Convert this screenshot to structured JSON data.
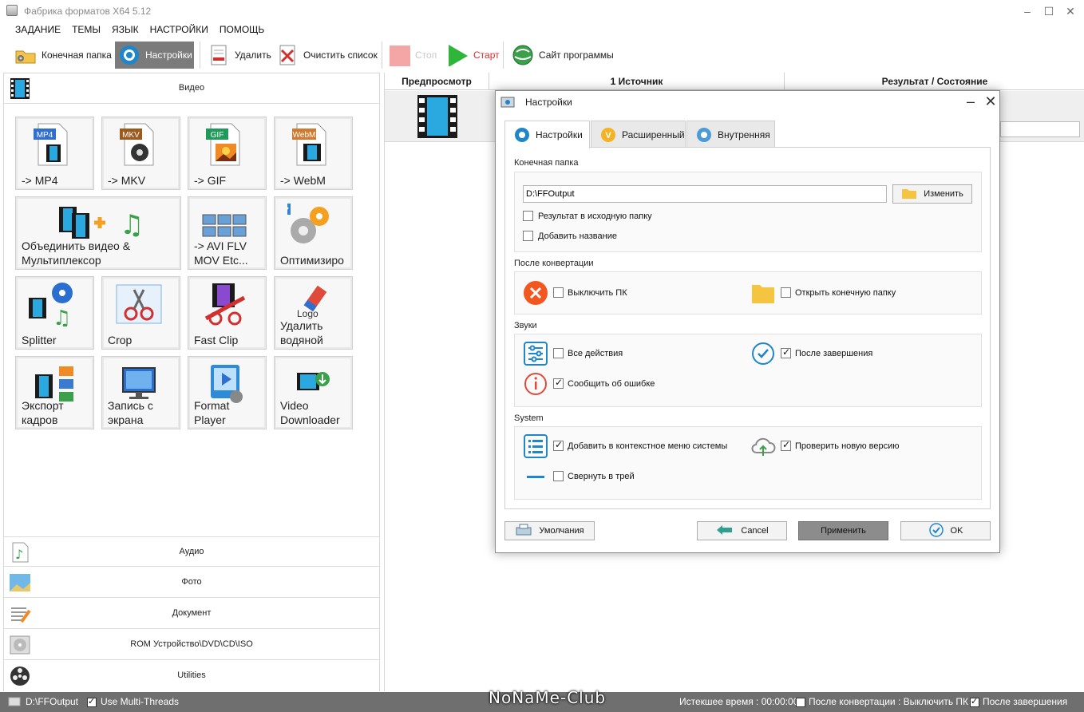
{
  "window": {
    "title": "Фабрика форматов X64 5.12",
    "minimize": "–",
    "maximize": "☐",
    "close": "✕"
  },
  "menu": [
    "ЗАДАНИЕ",
    "ТЕМЫ",
    "ЯЗЫК",
    "НАСТРОЙКИ",
    "ПОМОЩЬ"
  ],
  "toolbar": {
    "output_folder": "Конечная папка",
    "settings": "Настройки",
    "remove": "Удалить",
    "clear_list": "Очистить список",
    "stop": "Стоп",
    "start": "Старт",
    "website": "Сайт программы"
  },
  "left": {
    "video_header": "Видео",
    "tiles": [
      {
        "label": "-> MP4",
        "icon": "mp4-file-icon",
        "badge": "MP4",
        "badge_color": "#2f6fd0"
      },
      {
        "label": "-> MKV",
        "icon": "mkv-file-icon",
        "badge": "MKV",
        "badge_color": "#9c5a1c"
      },
      {
        "label": "-> GIF",
        "icon": "gif-file-icon",
        "badge": "GIF",
        "badge_color": "#1f9a5a"
      },
      {
        "label": "-> WebM",
        "icon": "webm-file-icon",
        "badge": "WebM",
        "badge_color": "#d07a2f"
      },
      {
        "label": "Объединить видео &\nМультиплексор",
        "icon": "join-video-icon"
      },
      {
        "label": "-> AVI FLV\nMOV Etc...",
        "icon": "multi-format-icon"
      },
      {
        "label": "Оптимизиро",
        "icon": "optimize-icon"
      },
      {
        "label": "Splitter",
        "icon": "splitter-icon"
      },
      {
        "label": "Crop",
        "icon": "crop-icon"
      },
      {
        "label": "Fast Clip",
        "icon": "fast-clip-icon"
      },
      {
        "label": "Удалить\nводяной",
        "icon": "remove-watermark-icon",
        "icon_text": "Logo"
      },
      {
        "label": "Экспорт\nкадров",
        "icon": "export-frames-icon"
      },
      {
        "label": "Запись с\nэкрана",
        "icon": "screen-record-icon"
      },
      {
        "label": "Format\nPlayer",
        "icon": "format-player-icon"
      },
      {
        "label": "Video\nDownloader",
        "icon": "video-downloader-icon"
      }
    ],
    "categories": [
      "Аудио",
      "Фото",
      "Документ",
      "ROM Устройство\\DVD\\CD\\ISO",
      "Utilities"
    ]
  },
  "file_list": {
    "columns": [
      "Предпросмотр",
      "1 Источник",
      "Результат / Состояние"
    ]
  },
  "status": {
    "folder": "D:\\FFOutput",
    "multithread": "Use Multi-Threads",
    "elapsed": "Истекшее время : 00:00:00",
    "after_convert": "После конвертации : Выключить ПК",
    "on_complete": "После завершения",
    "watermark": "NoNaMe-Club"
  },
  "dialog": {
    "title": "Настройки",
    "tabs": [
      "Настройки",
      "Расширенный",
      "Внутренняя"
    ],
    "output": {
      "title": "Конечная папка",
      "path": "D:\\FFOutput",
      "change": "Изменить",
      "to_source": "Результат в исходную папку",
      "to_source_checked": false,
      "add_name": "Добавить название",
      "add_name_checked": false
    },
    "after": {
      "title": "После конвертации",
      "shutdown": "Выключить ПК",
      "shutdown_checked": false,
      "open_folder": "Открыть конечную папку",
      "open_folder_checked": false
    },
    "sounds": {
      "title": "Звуки",
      "all": "Все действия",
      "all_checked": false,
      "complete": "После завершения",
      "complete_checked": true,
      "error": "Сообщить об ошибке",
      "error_checked": true
    },
    "system": {
      "title": "System",
      "context": "Добавить в контекстное меню системы",
      "context_checked": true,
      "update": "Проверить новую версию",
      "update_checked": true,
      "tray": "Свернуть в трей",
      "tray_checked": false
    },
    "buttons": {
      "defaults": "Умолчания",
      "cancel": "Cancel",
      "apply": "Применить",
      "ok": "OK"
    }
  },
  "colors": {
    "accent_blue": "#1f86c9",
    "danger": "#f2571f",
    "folder": "#f5c542",
    "status_bar": "#6f6f6f"
  }
}
